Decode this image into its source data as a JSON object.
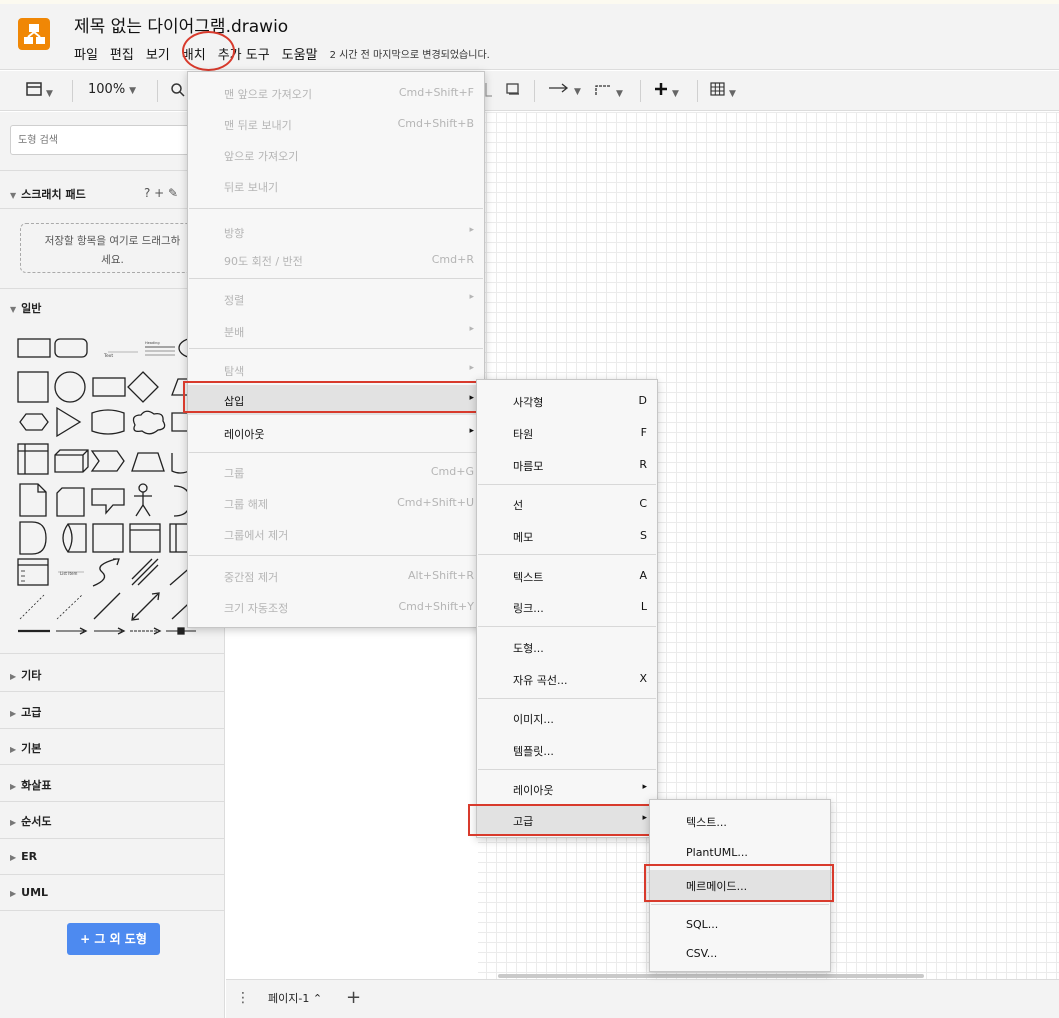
{
  "app": {
    "document_title": "제목 없는 다이어그램.drawio",
    "last_modified": "2 시간 전 마지막으로 변경되었습니다."
  },
  "menubar": [
    "파일",
    "편집",
    "보기",
    "배치",
    "추가 도구",
    "도움말"
  ],
  "toolbar": {
    "zoom": "100%"
  },
  "sidebar": {
    "search_placeholder": "도형 검색",
    "scratchpad_title": "스크래치 패드",
    "scratchpad_tools": "? + ✎",
    "scratchpad_hint_line1": "저장할 항목을 여기로 드래그하",
    "scratchpad_hint_line2": "세요.",
    "general_title": "일반",
    "shape_text_label": "Text",
    "shape_heading_label": "Heading",
    "shape_list_label": "List Item",
    "sections": [
      "기타",
      "고급",
      "기본",
      "화살표",
      "순서도",
      "ER",
      "UML"
    ],
    "more_shapes_button": "+ 그 외 도형"
  },
  "pagebar": {
    "page_tab": "페이지-1 ⌃"
  },
  "arrange_menu": {
    "items": [
      {
        "label": "맨 앞으로 가져오기",
        "shortcut": "Cmd+Shift+F",
        "enabled": false
      },
      {
        "label": "맨 뒤로 보내기",
        "shortcut": "Cmd+Shift+B",
        "enabled": false
      },
      {
        "label": "앞으로 가져오기",
        "shortcut": "",
        "enabled": false
      },
      {
        "label": "뒤로 보내기",
        "shortcut": "",
        "enabled": false
      },
      {
        "label": "방향",
        "shortcut": "",
        "enabled": false,
        "submenu": true
      },
      {
        "label": "90도 회전 / 반전",
        "shortcut": "Cmd+R",
        "enabled": false
      },
      {
        "label": "정렬",
        "shortcut": "",
        "enabled": false,
        "submenu": true
      },
      {
        "label": "분배",
        "shortcut": "",
        "enabled": false,
        "submenu": true
      },
      {
        "label": "탐색",
        "shortcut": "",
        "enabled": false,
        "submenu": true
      },
      {
        "label": "삽입",
        "shortcut": "",
        "enabled": true,
        "submenu": true,
        "highlighted": true
      },
      {
        "label": "레이아웃",
        "shortcut": "",
        "enabled": true,
        "submenu": true
      },
      {
        "label": "그룹",
        "shortcut": "Cmd+G",
        "enabled": false
      },
      {
        "label": "그룹 해제",
        "shortcut": "Cmd+Shift+U",
        "enabled": false
      },
      {
        "label": "그룹에서 제거",
        "shortcut": "",
        "enabled": false
      },
      {
        "label": "중간점 제거",
        "shortcut": "Alt+Shift+R",
        "enabled": false
      },
      {
        "label": "크기 자동조정",
        "shortcut": "Cmd+Shift+Y",
        "enabled": false
      }
    ]
  },
  "insert_menu": {
    "items": [
      {
        "label": "사각형",
        "shortcut": "D"
      },
      {
        "label": "타원",
        "shortcut": "F"
      },
      {
        "label": "마름모",
        "shortcut": "R"
      },
      {
        "label": "선",
        "shortcut": "C"
      },
      {
        "label": "메모",
        "shortcut": "S"
      },
      {
        "label": "텍스트",
        "shortcut": "A"
      },
      {
        "label": "링크...",
        "shortcut": "L"
      },
      {
        "label": "도형...",
        "shortcut": ""
      },
      {
        "label": "자유 곡선...",
        "shortcut": "X"
      },
      {
        "label": "이미지...",
        "shortcut": ""
      },
      {
        "label": "템플릿...",
        "shortcut": ""
      },
      {
        "label": "레이아웃",
        "shortcut": "",
        "submenu": true
      },
      {
        "label": "고급",
        "shortcut": "",
        "submenu": true,
        "highlighted": true
      }
    ]
  },
  "advanced_menu": {
    "items": [
      {
        "label": "텍스트..."
      },
      {
        "label": "PlantUML..."
      },
      {
        "label": "메르메이드...",
        "highlighted": true
      },
      {
        "label": "SQL..."
      },
      {
        "label": "CSV..."
      }
    ]
  },
  "colors": {
    "accent_red": "#d83a2c",
    "logo_orange": "#f08705",
    "button_blue": "#4d8af0"
  }
}
